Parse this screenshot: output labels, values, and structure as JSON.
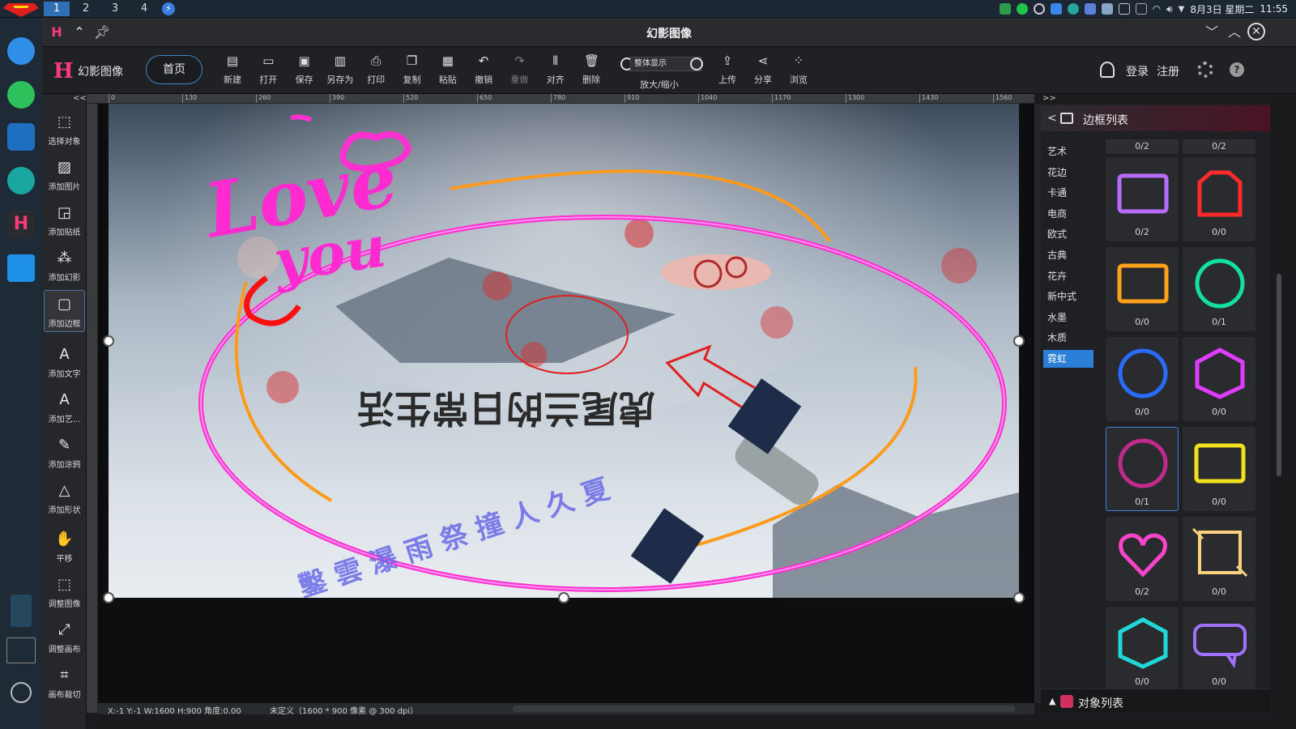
{
  "os": {
    "workspaces": [
      "1",
      "2",
      "3",
      "4"
    ],
    "active_workspace": "1",
    "date": "8月3日 星期二",
    "time": "11:55"
  },
  "window": {
    "title": "幻影图像"
  },
  "toolbar": {
    "brand_logo": "H",
    "brand_name": "幻影图像",
    "home": "首页",
    "tools": [
      {
        "label": "新建",
        "icon": "new-file-icon",
        "disabled": false
      },
      {
        "label": "打开",
        "icon": "open-folder-icon",
        "disabled": false
      },
      {
        "label": "保存",
        "icon": "save-icon",
        "disabled": false
      },
      {
        "label": "另存为",
        "icon": "save-as-icon",
        "disabled": false
      },
      {
        "label": "打印",
        "icon": "print-icon",
        "disabled": false
      },
      {
        "label": "复制",
        "icon": "copy-icon",
        "disabled": false
      },
      {
        "label": "粘贴",
        "icon": "paste-icon",
        "disabled": false
      },
      {
        "label": "撤销",
        "icon": "undo-icon",
        "disabled": false
      },
      {
        "label": "重做",
        "icon": "redo-icon",
        "disabled": true
      },
      {
        "label": "对齐",
        "icon": "align-icon",
        "disabled": false
      },
      {
        "label": "删除",
        "icon": "delete-icon",
        "disabled": false
      }
    ],
    "zoom_value": "整体显示",
    "zoom_label": "放大/缩小",
    "right_tools": [
      {
        "label": "上传",
        "icon": "upload-icon"
      },
      {
        "label": "分享",
        "icon": "share-icon"
      },
      {
        "label": "浏览",
        "icon": "browse-icon"
      }
    ],
    "login": "登录",
    "register": "注册"
  },
  "left_tools": [
    {
      "label": "选择对象",
      "icon": "select-object-icon",
      "active": false
    },
    {
      "label": "添加图片",
      "icon": "add-image-icon",
      "active": false
    },
    {
      "label": "添加贴纸",
      "icon": "add-sticker-icon",
      "active": false
    },
    {
      "label": "添加幻影",
      "icon": "add-phantom-icon",
      "active": false
    },
    {
      "label": "添加边框",
      "icon": "add-frame-icon",
      "active": true
    },
    {
      "label": "添加文字",
      "icon": "add-text-icon",
      "active": false
    },
    {
      "label": "添加艺...",
      "icon": "add-art-text-icon",
      "active": false
    },
    {
      "label": "添加涂鸦",
      "icon": "add-doodle-icon",
      "active": false
    },
    {
      "label": "添加形状",
      "icon": "add-shape-icon",
      "active": false
    },
    {
      "label": "平移",
      "icon": "pan-hand-icon",
      "active": false
    },
    {
      "label": "调整图像",
      "icon": "adjust-image-icon",
      "active": false
    },
    {
      "label": "调整画布",
      "icon": "adjust-canvas-icon",
      "active": false
    },
    {
      "label": "画布裁切",
      "icon": "crop-canvas-icon",
      "active": false
    }
  ],
  "ruler_ticks": [
    "0",
    "130",
    "260",
    "390",
    "520",
    "650",
    "780",
    "910",
    "1040",
    "1170",
    "1300",
    "1430",
    "1560"
  ],
  "canvas": {
    "text_love": "Love",
    "text_you": "you",
    "art_text": "虎尾兰的日常生活",
    "vertical_text": "鑿 雲 瀑 雨 祭 撞 人 久 夏"
  },
  "status": {
    "coords": "X:-1 Y:-1 W:1600 H:900 角度:0.00",
    "doc": "未定义（1600 * 900 像素 @ 300 dpi）"
  },
  "right_panel": {
    "collapse": ">>",
    "back": "<",
    "title": "边框列表",
    "categories": [
      "艺术",
      "花边",
      "卡通",
      "电商",
      "欧式",
      "古典",
      "花卉",
      "新中式",
      "水墨",
      "木质",
      "霓虹"
    ],
    "active_category": "霓虹",
    "col_heads": [
      "0/2",
      "0/2"
    ],
    "frames": [
      {
        "count": "0/2",
        "color": "#b86cff",
        "shape": "rect"
      },
      {
        "count": "0/0",
        "color": "#ff2a2a",
        "shape": "tab"
      },
      {
        "count": "0/0",
        "color": "#ffa21a",
        "shape": "rect"
      },
      {
        "count": "0/1",
        "color": "#12e0a0",
        "shape": "circle"
      },
      {
        "count": "0/0",
        "color": "#2a6bff",
        "shape": "circle"
      },
      {
        "count": "0/0",
        "color": "#e03cff",
        "shape": "hex"
      },
      {
        "count": "0/1",
        "color": "#c02a8a",
        "shape": "circle"
      },
      {
        "count": "0/0",
        "color": "#f0e020",
        "shape": "rect"
      },
      {
        "count": "0/2",
        "color": "#ff44cc",
        "shape": "heart"
      },
      {
        "count": "0/0",
        "color": "#ffd080",
        "shape": "square"
      },
      {
        "count": "0/0",
        "color": "#20d8d8",
        "shape": "hex"
      },
      {
        "count": "0/0",
        "color": "#a070ff",
        "shape": "bubble"
      }
    ],
    "object_list": "对象列表"
  }
}
